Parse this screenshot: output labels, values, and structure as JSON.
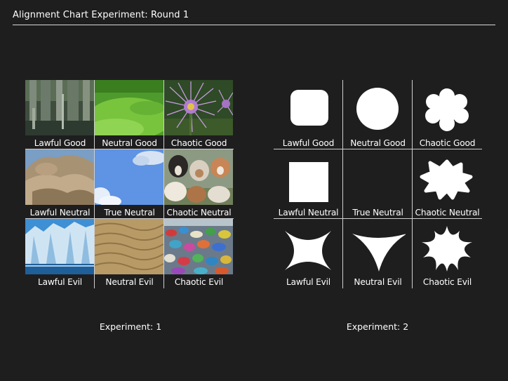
{
  "header": {
    "title": "Alignment Chart Experiment: Round 1"
  },
  "experiment1": {
    "caption": "Experiment: 1",
    "cells": [
      {
        "label": "Lawful Good",
        "image": "cypress-swamp-trees"
      },
      {
        "label": "Neutral Good",
        "image": "green-grass"
      },
      {
        "label": "Chaotic Good",
        "image": "purple-thistle-flower"
      },
      {
        "label": "Lawful Neutral",
        "image": "rocky-boulders"
      },
      {
        "label": "True Neutral",
        "image": "blue-sky-clouds"
      },
      {
        "label": "Chaotic Neutral",
        "image": "cattle-herd"
      },
      {
        "label": "Lawful Evil",
        "image": "glacier-ice"
      },
      {
        "label": "Neutral Evil",
        "image": "sand-dunes"
      },
      {
        "label": "Chaotic Evil",
        "image": "plastic-waste-pile"
      }
    ]
  },
  "experiment2": {
    "caption": "Experiment: 2",
    "cells": [
      {
        "label": "Lawful Good",
        "shape": "rounded-square"
      },
      {
        "label": "Neutral Good",
        "shape": "circle"
      },
      {
        "label": "Chaotic Good",
        "shape": "flower-blob"
      },
      {
        "label": "Lawful Neutral",
        "shape": "square"
      },
      {
        "label": "True Neutral",
        "shape": "none"
      },
      {
        "label": "Chaotic Neutral",
        "shape": "splat-blob"
      },
      {
        "label": "Lawful Evil",
        "shape": "concave-star-4"
      },
      {
        "label": "Neutral Evil",
        "shape": "concave-triangle"
      },
      {
        "label": "Chaotic Evil",
        "shape": "concave-star-8"
      }
    ]
  },
  "colors": {
    "background": "#1f1e1f",
    "foreground": "#ffffff",
    "rule": "#d8d8d8"
  }
}
